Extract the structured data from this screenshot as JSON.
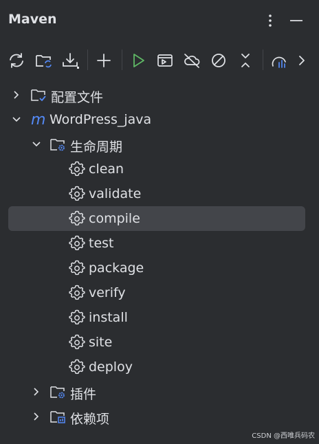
{
  "panel": {
    "title": "Maven"
  },
  "header_actions": [
    "more-options-icon",
    "minimize-icon"
  ],
  "toolbar": {
    "icons": [
      "reload-icon",
      "add-folder-sync-icon",
      "download-icon",
      "add-icon",
      "run-icon",
      "execute-goal-icon",
      "offline-icon",
      "skip-tests-icon",
      "collapse-icon",
      "analyze-deps-icon",
      "more-chevron-icon"
    ]
  },
  "tree": {
    "profiles": "配置文件",
    "project": "WordPress_java",
    "lifecycle": "生命周期",
    "goals": [
      "clean",
      "validate",
      "compile",
      "test",
      "package",
      "verify",
      "install",
      "site",
      "deploy"
    ],
    "selected_goal": "compile",
    "plugins": "插件",
    "dependencies": "依赖项"
  },
  "colors": {
    "background": "#2b2d30",
    "selection": "#43454a",
    "text": "#dfe1e5",
    "accent_blue": "#548af7",
    "run_green": "#5fb865"
  },
  "watermark": "CSDN @西唯兵码农"
}
